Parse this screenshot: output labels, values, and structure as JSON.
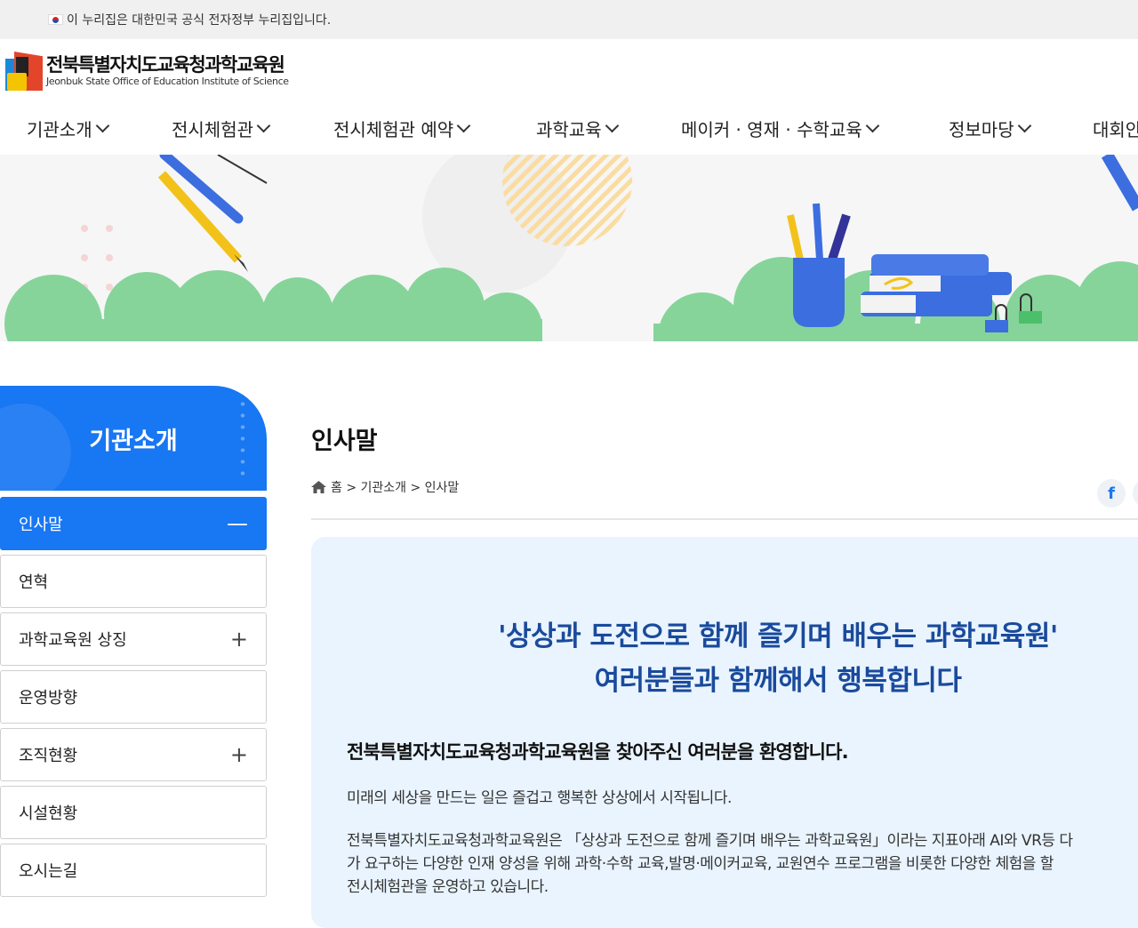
{
  "gov_banner": {
    "text": "이 누리집은 대한민국 공식 전자정부 누리집입니다."
  },
  "logo": {
    "name_ko": "전북특별자치도교육청과학교육원",
    "name_en": "Jeonbuk State Office of Education Institute of Science"
  },
  "nav": {
    "items": [
      {
        "label": "기관소개"
      },
      {
        "label": "전시체험관"
      },
      {
        "label": "전시체험관 예약"
      },
      {
        "label": "과학교육"
      },
      {
        "label": "메이커 · 영재 · 수학교육"
      },
      {
        "label": "정보마당"
      },
      {
        "label": "대회안"
      }
    ]
  },
  "sidebar": {
    "title": "기관소개",
    "items": [
      {
        "label": "인사말",
        "icon": "minus-icon",
        "glyph": "—",
        "active": true
      },
      {
        "label": "연혁",
        "icon": "",
        "glyph": ""
      },
      {
        "label": "과학교육원 상징",
        "icon": "plus-icon",
        "glyph": "+"
      },
      {
        "label": "운영방향",
        "icon": "",
        "glyph": ""
      },
      {
        "label": "조직현황",
        "icon": "plus-icon",
        "glyph": "+"
      },
      {
        "label": "시설현황",
        "icon": "",
        "glyph": ""
      },
      {
        "label": "오시는길",
        "icon": "",
        "glyph": ""
      }
    ]
  },
  "content": {
    "title": "인사말",
    "breadcrumb": "홈 > 기관소개 > 인사말",
    "share_label": "f",
    "slogan_line1": "'상상과 도전으로 함께 즐기며 배우는 과학교육원'",
    "slogan_line2": "여러분들과 함께해서 행복합니다",
    "welcome": "전북특별자치도교육청과학교육원을 찾아주신 여러분을 환영합니다.",
    "para1": "미래의 세상을 만드는 일은 즐겁고 행복한 상상에서 시작됩니다.",
    "para2_line1": "전북특별자치도교육청과학교육원은 「상상과 도전으로 함께 즐기며 배우는 과학교육원」이라는 지표아래 AI와 VR등 다",
    "para2_line2": "가 요구하는 다양한 인재 양성을 위해 과학·수학 교육,발명·메이커교육, 교원연수 프로그램을 비롯한 다양한 체험을 할",
    "para2_line3": "전시체험관을 운영하고 있습니다."
  },
  "colors": {
    "primary": "#1877f2",
    "slogan": "#1a4a9c",
    "greet_bg": "#e9f4ff",
    "cloud": "#86d49a"
  }
}
